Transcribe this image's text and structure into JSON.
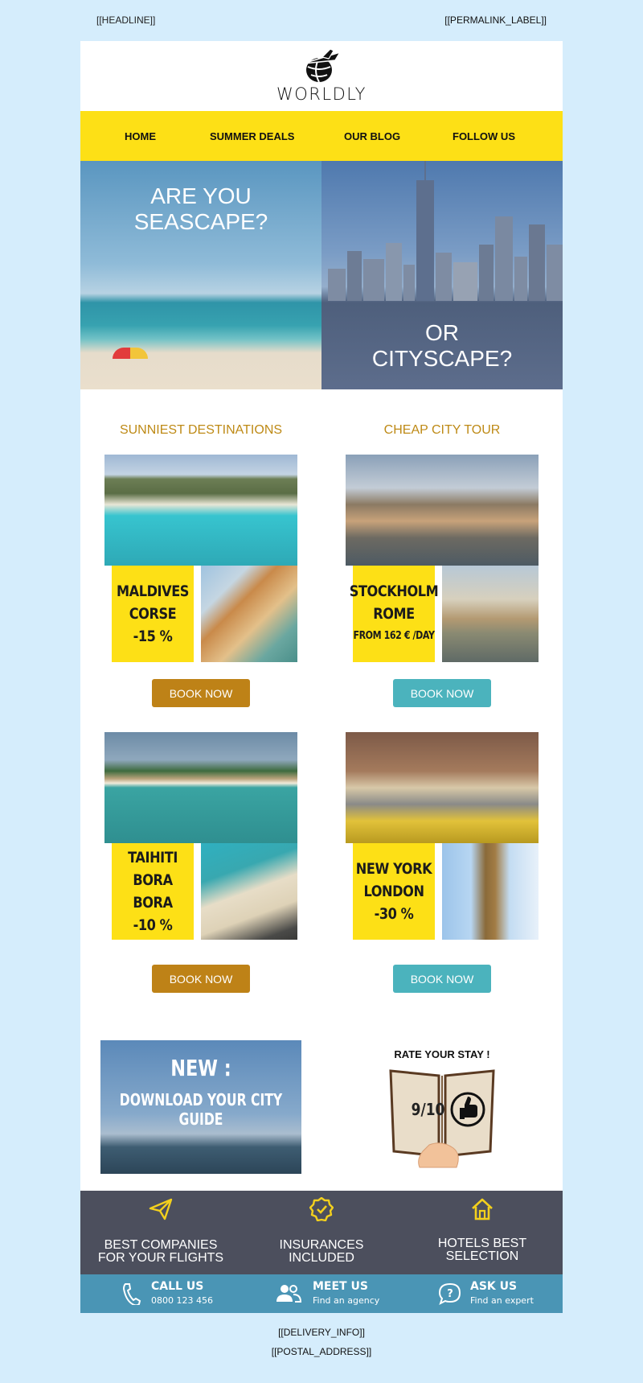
{
  "preheader": {
    "headline": "[[HEADLINE]]",
    "permalink_label": "[[PERMALINK_LABEL]]"
  },
  "brand": {
    "name": "WORLDLY"
  },
  "nav": [
    "HOME",
    "SUMMER DEALS",
    "OUR BLOG",
    "FOLLOW US"
  ],
  "hero": {
    "left_text": [
      "ARE YOU",
      "SEASCAPE?"
    ],
    "right_text": [
      "OR",
      "CITYSCAPE?"
    ]
  },
  "columns": {
    "left_title": "SUNNIEST DESTINATIONS",
    "right_title": "CHEAP CITY TOUR"
  },
  "cards": [
    {
      "line1": "MALDIVES",
      "line2": "CORSE",
      "line3": "-15 %",
      "button": "BOOK NOW"
    },
    {
      "line1": "STOCKHOLM",
      "line2": "ROME",
      "line3": "FROM 162 € /DAY",
      "button": "BOOK NOW"
    },
    {
      "line1": "TAIHITI",
      "line2": "BORA BORA",
      "line3": "-10 %",
      "button": "BOOK NOW"
    },
    {
      "line1": "NEW YORK",
      "line2": "LONDON",
      "line3": "-30 %",
      "button": "BOOK NOW"
    }
  ],
  "promo": {
    "title": "NEW :",
    "subtitle": "DOWNLOAD YOUR CITY GUIDE"
  },
  "rating": {
    "title": "RATE YOUR STAY !",
    "score": "9/10"
  },
  "features": [
    {
      "icon": "paper-plane-icon",
      "line1": "BEST COMPANIES",
      "line2": "FOR YOUR FLIGHTS"
    },
    {
      "icon": "check-badge-icon",
      "line1": "INSURANCES",
      "line2": "INCLUDED"
    },
    {
      "icon": "home-icon",
      "line1": "HOTELS BEST",
      "line2": "SELECTION"
    }
  ],
  "contact": [
    {
      "icon": "phone-icon",
      "label": "CALL US",
      "sub": "0800 123 456"
    },
    {
      "icon": "people-icon",
      "label": "MEET US",
      "sub": "Find an agency"
    },
    {
      "icon": "speech-bubble-icon",
      "label": "ASK US",
      "sub": "Find an expert"
    }
  ],
  "footer": {
    "delivery": "[[DELIVERY_INFO]]",
    "address": "[[POSTAL_ADDRESS]]"
  },
  "colors": {
    "yellow": "#fde016",
    "gold": "#be8217",
    "teal": "#4bb3bd",
    "dark": "#4c4f5d",
    "contact_blue": "#4a95b5",
    "page_bg": "#d5edfc"
  }
}
